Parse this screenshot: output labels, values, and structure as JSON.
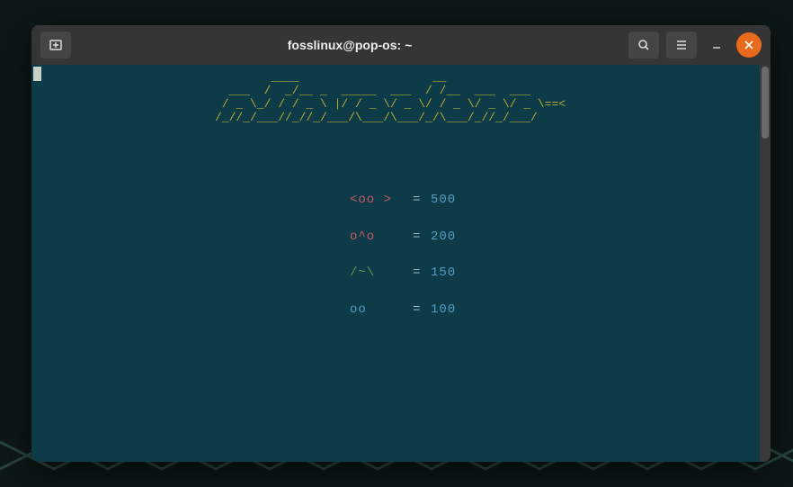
{
  "window": {
    "title": "fosslinux@pop-os: ~"
  },
  "ascii_logo_lines": [
    "        ____                   __",
    "  ___  /  _/__ _  _____  ___  / /__  ___  ___",
    " / _ \\_/ / / _ \\ |/ / _ \\/ _ \\/ / _ \\/ _ \\/ _ \\==<",
    "/_//_/___//_//_/___/\\___/\\___/_/\\___/_//_/___/"
  ],
  "scores": [
    {
      "icon": "<oo >",
      "color_class": "c-red",
      "value": "500"
    },
    {
      "icon": "o^o",
      "color_class": "c-red",
      "value": "200"
    },
    {
      "icon": "/~\\",
      "color_class": "c-green",
      "value": "150"
    },
    {
      "icon": "oo",
      "color_class": "c-blue",
      "value": "100"
    }
  ],
  "eq": "="
}
